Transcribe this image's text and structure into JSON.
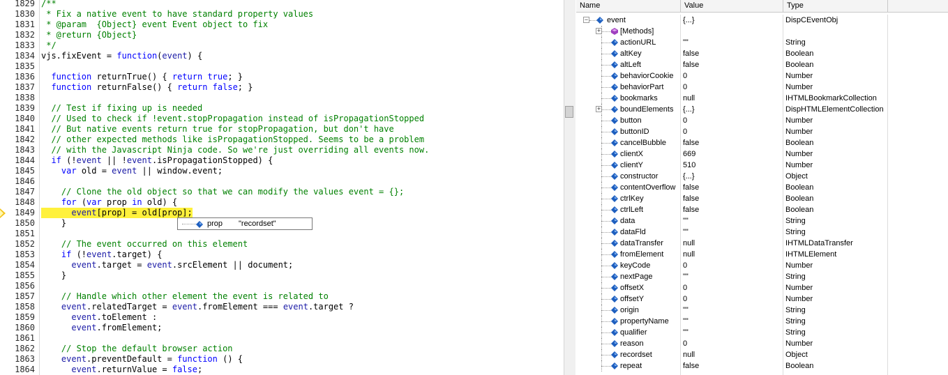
{
  "editor": {
    "lines": [
      {
        "num": "1829",
        "code": "/**",
        "cls": "tk-cm"
      },
      {
        "num": "1830",
        "code": " * Fix a native event to have standard property values",
        "cls": "tk-cm"
      },
      {
        "num": "1831",
        "code": " * @param  {Object} event Event object to fix",
        "cls": "tk-cm"
      },
      {
        "num": "1832",
        "code": " * @return {Object}",
        "cls": "tk-cm"
      },
      {
        "num": "1833",
        "code": " */",
        "cls": "tk-cm"
      },
      {
        "num": "1834",
        "code": "vjs.fixEvent = function(event) {",
        "cls": ""
      },
      {
        "num": "1835",
        "code": "",
        "cls": ""
      },
      {
        "num": "1836",
        "code": "  function returnTrue() { return true; }",
        "cls": ""
      },
      {
        "num": "1837",
        "code": "  function returnFalse() { return false; }",
        "cls": ""
      },
      {
        "num": "1838",
        "code": "",
        "cls": ""
      },
      {
        "num": "1839",
        "code": "  // Test if fixing up is needed",
        "cls": "tk-cm"
      },
      {
        "num": "1840",
        "code": "  // Used to check if !event.stopPropagation instead of isPropagationStopped",
        "cls": "tk-cm"
      },
      {
        "num": "1841",
        "code": "  // But native events return true for stopPropagation, but don't have",
        "cls": "tk-cm"
      },
      {
        "num": "1842",
        "code": "  // other expected methods like isPropagationStopped. Seems to be a problem",
        "cls": "tk-cm"
      },
      {
        "num": "1843",
        "code": "  // with the Javascript Ninja code. So we're just overriding all events now.",
        "cls": "tk-cm"
      },
      {
        "num": "1844",
        "code": "  if (!event || !event.isPropagationStopped) {",
        "cls": ""
      },
      {
        "num": "1845",
        "code": "    var old = event || window.event;",
        "cls": ""
      },
      {
        "num": "1846",
        "code": "",
        "cls": ""
      },
      {
        "num": "1847",
        "code": "    // Clone the old object so that we can modify the values event = {};",
        "cls": "tk-cm"
      },
      {
        "num": "1848",
        "code": "    for (var prop in old) {",
        "cls": ""
      },
      {
        "num": "1849",
        "code": "      event[prop] = old[prop];",
        "cls": "hl"
      },
      {
        "num": "1850",
        "code": "    }",
        "cls": ""
      },
      {
        "num": "1851",
        "code": "",
        "cls": ""
      },
      {
        "num": "1852",
        "code": "    // The event occurred on this element",
        "cls": "tk-cm"
      },
      {
        "num": "1853",
        "code": "    if (!event.target) {",
        "cls": ""
      },
      {
        "num": "1854",
        "code": "      event.target = event.srcElement || document;",
        "cls": ""
      },
      {
        "num": "1855",
        "code": "    }",
        "cls": ""
      },
      {
        "num": "1856",
        "code": "",
        "cls": ""
      },
      {
        "num": "1857",
        "code": "    // Handle which other element the event is related to",
        "cls": "tk-cm"
      },
      {
        "num": "1858",
        "code": "    event.relatedTarget = event.fromElement === event.target ?",
        "cls": ""
      },
      {
        "num": "1859",
        "code": "      event.toElement :",
        "cls": ""
      },
      {
        "num": "1860",
        "code": "      event.fromElement;",
        "cls": ""
      },
      {
        "num": "1861",
        "code": "",
        "cls": ""
      },
      {
        "num": "1862",
        "code": "    // Stop the default browser action",
        "cls": "tk-cm"
      },
      {
        "num": "1863",
        "code": "    event.preventDefault = function () {",
        "cls": ""
      },
      {
        "num": "1864",
        "code": "      event.returnValue = false;",
        "cls": ""
      }
    ],
    "datatip": {
      "name": "prop",
      "value": "\"recordset\""
    }
  },
  "locals": {
    "columns": {
      "name": "Name",
      "value": "Value",
      "type": "Type"
    },
    "root": {
      "name": "event",
      "value": "{...}",
      "type": "DispCEventObj"
    },
    "rows": [
      {
        "name": "[Methods]",
        "value": "",
        "type": "",
        "kind": "methods",
        "expandable": true
      },
      {
        "name": "actionURL",
        "value": "\"\"",
        "type": "String"
      },
      {
        "name": "altKey",
        "value": "false",
        "type": "Boolean"
      },
      {
        "name": "altLeft",
        "value": "false",
        "type": "Boolean"
      },
      {
        "name": "behaviorCookie",
        "value": "0",
        "type": "Number"
      },
      {
        "name": "behaviorPart",
        "value": "0",
        "type": "Number"
      },
      {
        "name": "bookmarks",
        "value": "null",
        "type": "IHTMLBookmarkCollection"
      },
      {
        "name": "boundElements",
        "value": "{...}",
        "type": "DispHTMLElementCollection",
        "expandable": true
      },
      {
        "name": "button",
        "value": "0",
        "type": "Number"
      },
      {
        "name": "buttonID",
        "value": "0",
        "type": "Number"
      },
      {
        "name": "cancelBubble",
        "value": "false",
        "type": "Boolean"
      },
      {
        "name": "clientX",
        "value": "669",
        "type": "Number"
      },
      {
        "name": "clientY",
        "value": "510",
        "type": "Number"
      },
      {
        "name": "constructor",
        "value": "{...}",
        "type": "Object"
      },
      {
        "name": "contentOverflow",
        "value": "false",
        "type": "Boolean"
      },
      {
        "name": "ctrlKey",
        "value": "false",
        "type": "Boolean"
      },
      {
        "name": "ctrlLeft",
        "value": "false",
        "type": "Boolean"
      },
      {
        "name": "data",
        "value": "\"\"",
        "type": "String"
      },
      {
        "name": "dataFld",
        "value": "\"\"",
        "type": "String"
      },
      {
        "name": "dataTransfer",
        "value": "null",
        "type": "IHTMLDataTransfer"
      },
      {
        "name": "fromElement",
        "value": "null",
        "type": "IHTMLElement"
      },
      {
        "name": "keyCode",
        "value": "0",
        "type": "Number"
      },
      {
        "name": "nextPage",
        "value": "\"\"",
        "type": "String"
      },
      {
        "name": "offsetX",
        "value": "0",
        "type": "Number"
      },
      {
        "name": "offsetY",
        "value": "0",
        "type": "Number"
      },
      {
        "name": "origin",
        "value": "\"\"",
        "type": "String"
      },
      {
        "name": "propertyName",
        "value": "\"\"",
        "type": "String"
      },
      {
        "name": "qualifier",
        "value": "\"\"",
        "type": "String"
      },
      {
        "name": "reason",
        "value": "0",
        "type": "Number"
      },
      {
        "name": "recordset",
        "value": "null",
        "type": "Object"
      },
      {
        "name": "repeat",
        "value": "false",
        "type": "Boolean"
      }
    ]
  },
  "icons": {
    "property_color": "#1e5fbf",
    "methods_color": "#a040c0",
    "exec_arrow_color": "#f3c31a",
    "highlight_color": "#fff13c"
  }
}
